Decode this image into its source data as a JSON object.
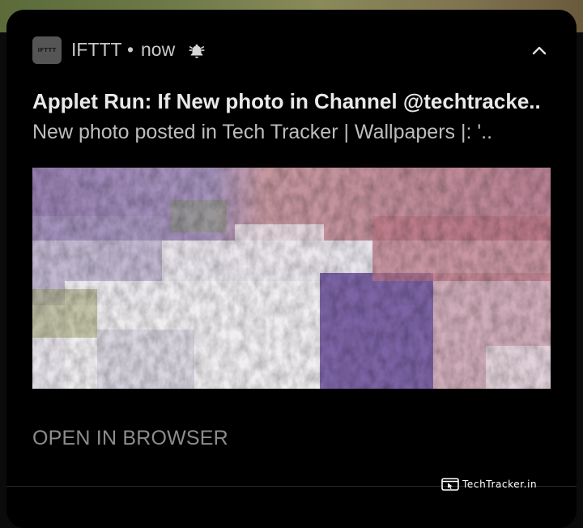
{
  "notification": {
    "app_icon_text": "IFTTT",
    "app_name": "IFTTT",
    "separator": "•",
    "time": "now",
    "title": "Applet Run: If New photo in Channel @techtracke..",
    "body": "New photo posted in Tech Tracker | Wallpapers |: '..",
    "action_label": "OPEN IN BROWSER"
  },
  "watermark": {
    "text": "TechTracker.in"
  },
  "icons": {
    "bell": "bell-icon",
    "chevron": "chevron-up-icon",
    "watermark_logo": "browser-cursor-icon"
  }
}
